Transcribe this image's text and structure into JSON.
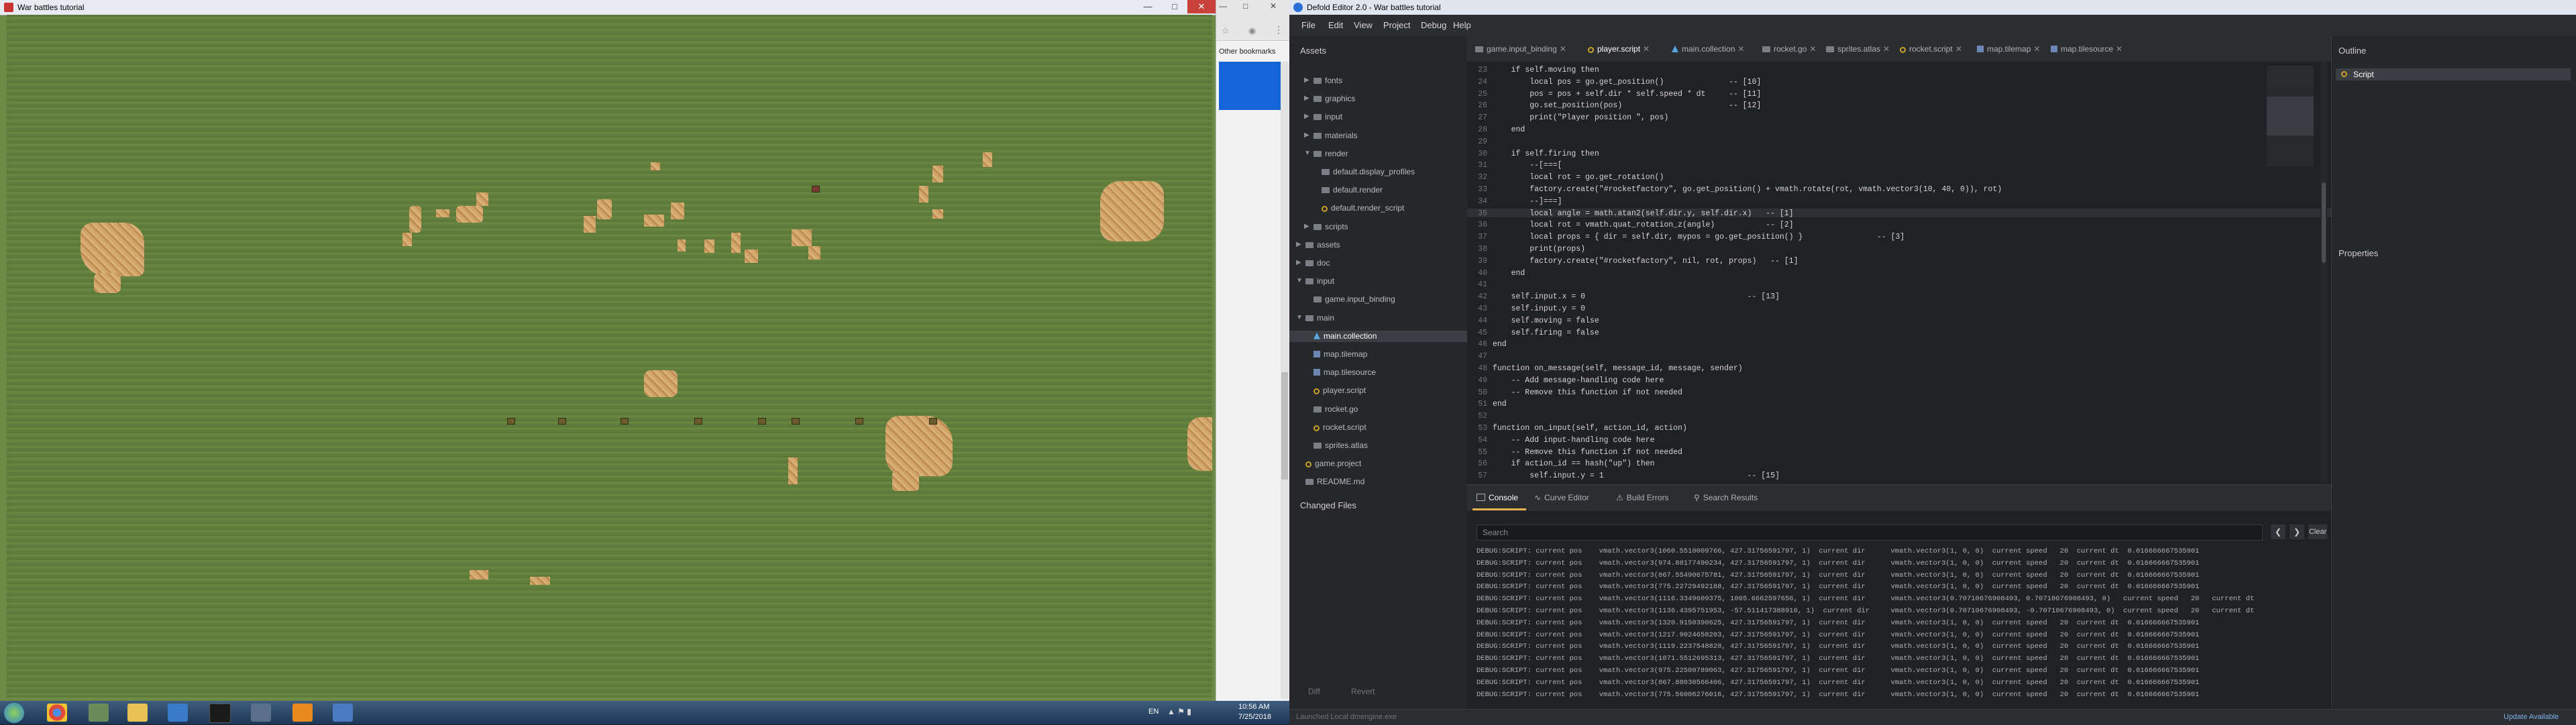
{
  "game": {
    "title": "War battles tutorial"
  },
  "browser": {
    "bookmarks_label": "Other bookmarks"
  },
  "editor": {
    "title": "Defold Editor 2.0 - War battles tutorial",
    "menu": [
      "File",
      "Edit",
      "View",
      "Project",
      "Debug",
      "Help"
    ],
    "assets_title": "Assets",
    "tree": [
      {
        "label": "fonts",
        "depth": 1,
        "kind": "folder",
        "arrow": "▶"
      },
      {
        "label": "graphics",
        "depth": 1,
        "kind": "folder",
        "arrow": "▶"
      },
      {
        "label": "input",
        "depth": 1,
        "kind": "folder",
        "arrow": "▶"
      },
      {
        "label": "materials",
        "depth": 1,
        "kind": "folder",
        "arrow": "▶"
      },
      {
        "label": "render",
        "depth": 1,
        "kind": "folder",
        "arrow": "▼"
      },
      {
        "label": "default.display_profiles",
        "depth": 2,
        "kind": "file"
      },
      {
        "label": "default.render",
        "depth": 2,
        "kind": "file"
      },
      {
        "label": "default.render_script",
        "depth": 2,
        "kind": "script"
      },
      {
        "label": "scripts",
        "depth": 1,
        "kind": "folder",
        "arrow": "▶"
      },
      {
        "label": "assets",
        "depth": 0,
        "kind": "folder",
        "arrow": "▶"
      },
      {
        "label": "doc",
        "depth": 0,
        "kind": "folder",
        "arrow": "▶"
      },
      {
        "label": "input",
        "depth": 0,
        "kind": "folder",
        "arrow": "▼"
      },
      {
        "label": "game.input_binding",
        "depth": 1,
        "kind": "file"
      },
      {
        "label": "main",
        "depth": 0,
        "kind": "folder",
        "arrow": "▼"
      },
      {
        "label": "main.collection",
        "depth": 1,
        "kind": "collection",
        "selected": true
      },
      {
        "label": "map.tilemap",
        "depth": 1,
        "kind": "tile"
      },
      {
        "label": "map.tilesource",
        "depth": 1,
        "kind": "tile"
      },
      {
        "label": "player.script",
        "depth": 1,
        "kind": "script"
      },
      {
        "label": "rocket.go",
        "depth": 1,
        "kind": "file"
      },
      {
        "label": "rocket.script",
        "depth": 1,
        "kind": "script"
      },
      {
        "label": "sprites.atlas",
        "depth": 1,
        "kind": "file"
      },
      {
        "label": "game.project",
        "depth": 0,
        "kind": "script"
      },
      {
        "label": "README.md",
        "depth": 0,
        "kind": "file"
      }
    ],
    "changed_files_title": "Changed Files",
    "diff_label": "Diff",
    "revert_label": "Revert",
    "tabs": [
      "game.input_binding",
      "player.script",
      "main.collection",
      "rocket.go",
      "sprites.atlas",
      "rocket.script",
      "map.tilemap",
      "map.tilesource"
    ],
    "active_tab": "player.script",
    "code_lines": [
      {
        "n": "23",
        "t": "    if self.moving then"
      },
      {
        "n": "24",
        "t": "        local pos = go.get_position()              -- [10]"
      },
      {
        "n": "25",
        "t": "        pos = pos + self.dir * self.speed * dt     -- [11]"
      },
      {
        "n": "26",
        "t": "        go.set_position(pos)                       -- [12]"
      },
      {
        "n": "27",
        "t": "        print(\"Player position \", pos)"
      },
      {
        "n": "28",
        "t": "    end"
      },
      {
        "n": "29",
        "t": ""
      },
      {
        "n": "30",
        "t": "    if self.firing then"
      },
      {
        "n": "31",
        "t": "        --[===["
      },
      {
        "n": "32",
        "t": "        local rot = go.get_rotation()"
      },
      {
        "n": "33",
        "t": "        factory.create(\"#rocketfactory\", go.get_position() + vmath.rotate(rot, vmath.vector3(10, 40, 0)), rot)"
      },
      {
        "n": "34",
        "t": "        --]===]"
      },
      {
        "n": "35",
        "t": "        local angle = math.atan2(self.dir.y, self.dir.x)   -- [1]"
      },
      {
        "n": "36",
        "t": "        local rot = vmath.quat_rotation_z(angle)           -- [2]"
      },
      {
        "n": "37",
        "t": "        local props = { dir = self.dir, mypos = go.get_position() }                -- [3]"
      },
      {
        "n": "38",
        "t": "        print(props)"
      },
      {
        "n": "39",
        "t": "        factory.create(\"#rocketfactory\", nil, rot, props)   -- [1]"
      },
      {
        "n": "40",
        "t": "    end"
      },
      {
        "n": "41",
        "t": ""
      },
      {
        "n": "42",
        "t": "    self.input.x = 0                                   -- [13]"
      },
      {
        "n": "43",
        "t": "    self.input.y = 0"
      },
      {
        "n": "44",
        "t": "    self.moving = false"
      },
      {
        "n": "45",
        "t": "    self.firing = false"
      },
      {
        "n": "46",
        "t": "end"
      },
      {
        "n": "47",
        "t": ""
      },
      {
        "n": "48",
        "t": "function on_message(self, message_id, message, sender)"
      },
      {
        "n": "49",
        "t": "    -- Add message-handling code here"
      },
      {
        "n": "50",
        "t": "    -- Remove this function if not needed"
      },
      {
        "n": "51",
        "t": "end"
      },
      {
        "n": "52",
        "t": ""
      },
      {
        "n": "53",
        "t": "function on_input(self, action_id, action)"
      },
      {
        "n": "54",
        "t": "    -- Add input-handling code here"
      },
      {
        "n": "55",
        "t": "    -- Remove this function if not needed"
      },
      {
        "n": "56",
        "t": "    if action_id == hash(\"up\") then"
      },
      {
        "n": "57",
        "t": "        self.input.y = 1                               -- [15]"
      }
    ],
    "outline_title": "Outline",
    "outline_item": "Script",
    "properties_title": "Properties",
    "console_tabs": [
      "Console",
      "Curve Editor",
      "Build Errors",
      "Search Results"
    ],
    "search_placeholder": "Search",
    "clear_label": "Clear",
    "console_lines": [
      "DEBUG:SCRIPT: current pos    vmath.vector3(1060.5510009766, 427.31756591797, 1)  current dir      vmath.vector3(1, 0, 0)  current speed   20  current dt  0.016666667535901",
      "DEBUG:SCRIPT: current pos    vmath.vector3(974.88177490234, 427.31756591797, 1)  current dir      vmath.vector3(1, 0, 0)  current speed   20  current dt  0.016666667535901",
      "DEBUG:SCRIPT: current pos    vmath.vector3(867.55490675781, 427.31756591797, 1)  current dir      vmath.vector3(1, 0, 0)  current speed   20  current dt  0.016666667535901",
      "DEBUG:SCRIPT: current pos    vmath.vector3(775.22729492188, 427.31756591797, 1)  current dir      vmath.vector3(1, 0, 0)  current speed   20  current dt  0.016666667535901",
      "DEBUG:SCRIPT: current pos    vmath.vector3(1116.3349609375, 1005.6662597656, 1)  current dir      vmath.vector3(0.70710676908493, 0.70710676908493, 0)   current speed   20   current dt",
      "DEBUG:SCRIPT: current pos    vmath.vector3(1136.4395751953, -57.511417388916, 1)  current dir     vmath.vector3(0.70710676908493, -0.70710676908493, 0)  current speed   20   current dt",
      "DEBUG:SCRIPT: current pos    vmath.vector3(1320.9150390625, 427.31756591797, 1)  current dir      vmath.vector3(1, 0, 0)  current speed   20  current dt  0.016666667535901",
      "DEBUG:SCRIPT: current pos    vmath.vector3(1217.9024658203, 427.31756591797, 1)  current dir      vmath.vector3(1, 0, 0)  current speed   20  current dt  0.016666667535901",
      "DEBUG:SCRIPT: current pos    vmath.vector3(1119.2237548828, 427.31756591797, 1)  current dir      vmath.vector3(1, 0, 0)  current speed   20  current dt  0.016666667535901",
      "DEBUG:SCRIPT: current pos    vmath.vector3(1071.5512695313, 427.31756591797, 1)  current dir      vmath.vector3(1, 0, 0)  current speed   20  current dt  0.016666667535901",
      "DEBUG:SCRIPT: current pos    vmath.vector3(975.22500789063, 427.31756591797, 1)  current dir      vmath.vector3(1, 0, 0)  current speed   20  current dt  0.016666667535901",
      "DEBUG:SCRIPT: current pos    vmath.vector3(867.88030566406, 427.31756591797, 1)  current dir      vmath.vector3(1, 0, 0)  current speed   20  current dt  0.016666667535901",
      "DEBUG:SCRIPT: current pos    vmath.vector3(775.56006276016, 427.31756591797, 1)  current dir      vmath.vector3(1, 0, 0)  current speed   20  current dt  0.016666667535901"
    ],
    "status_left": "Launched Local dmengine.exe",
    "update_label": "Update Available"
  },
  "taskbar": {
    "lang": "EN",
    "time": "10:56 AM",
    "date": "7/25/2018"
  }
}
